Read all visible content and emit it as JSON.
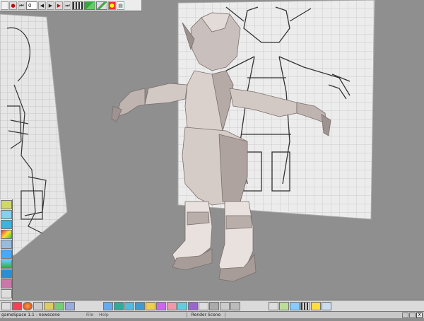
{
  "app": {
    "status_app_title": "gameSpace 1.1 - newscene",
    "menu_items": [
      "File",
      "Help"
    ],
    "active_tab": "Render Scene"
  },
  "top_toolbar": {
    "frame_value": "0",
    "icons": [
      "new-icon",
      "record-icon",
      "first-frame-icon",
      "frame-field",
      "step-back-icon",
      "step-forward-icon",
      "play-icon",
      "last-frame-icon",
      "timeline-icon",
      "paint-icon",
      "bones-icon",
      "material-icon",
      "render-icon"
    ]
  },
  "bottom_toolbar": {
    "icon_count": 26
  },
  "close_label": "X",
  "colors": {
    "viewport": "#8f8f8f",
    "toolbar": "#e6e6e6",
    "model": "#d9d0cc",
    "grid_plane": "#e9e9e9"
  }
}
